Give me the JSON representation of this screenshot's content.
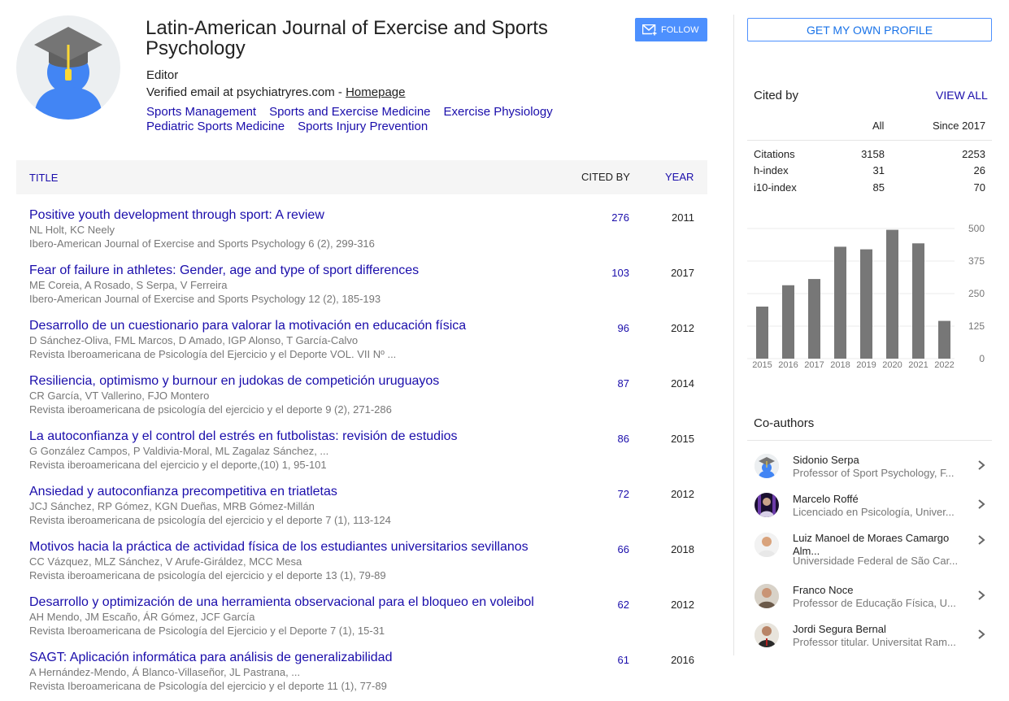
{
  "profile": {
    "name": "Latin-American Journal of Exercise and Sports Psychology",
    "affiliation": "Editor",
    "email_prefix": "Verified email at psychiatryres.com - ",
    "homepage_label": "Homepage",
    "interests": [
      "Sports Management",
      "Sports and Exercise Medicine",
      "Exercise Physiology",
      "Pediatric Sports Medicine",
      "Sports Injury Prevention"
    ],
    "follow_label": "FOLLOW"
  },
  "table": {
    "col_title": "TITLE",
    "col_cited": "CITED BY",
    "col_year": "YEAR",
    "rows": [
      {
        "title": "Positive youth development through sport: A review",
        "authors": "NL Holt, KC Neely",
        "venue": "Ibero-American Journal of Exercise and Sports Psychology 6 (2), 299-316",
        "cited": "276",
        "year": "2011"
      },
      {
        "title": "Fear of failure in athletes: Gender, age and type of sport differences",
        "authors": "ME Coreia, A Rosado, S Serpa, V Ferreira",
        "venue": "Ibero-American Journal of Exercise and Sports Psychology 12 (2), 185-193",
        "cited": "103",
        "year": "2017"
      },
      {
        "title": "Desarrollo de un cuestionario para valorar la motivación en educación física",
        "authors": "D Sánchez-Oliva, FML Marcos, D Amado, IGP Alonso, T García-Calvo",
        "venue": "Revista Iberoamericana de Psicología del Ejercicio y el Deporte VOL. VII Nº ...",
        "cited": "96",
        "year": "2012"
      },
      {
        "title": "Resiliencia, optimismo y burnour en judokas de competición uruguayos",
        "authors": "CR García, VT Vallerino, FJO Montero",
        "venue": "Revista iberoamericana de psicología del ejercicio y el deporte 9 (2), 271-286",
        "cited": "87",
        "year": "2014"
      },
      {
        "title": "La autoconfianza y el control del estrés en futbolistas: revisión de estudios",
        "authors": "G González Campos, P Valdivia-Moral, ML Zagalaz Sánchez, ...",
        "venue": "Revista iberoamericana del ejercicio y el deporte,(10) 1, 95-101",
        "cited": "86",
        "year": "2015"
      },
      {
        "title": "Ansiedad y autoconfianza precompetitiva en triatletas",
        "authors": "JCJ Sánchez, RP Gómez, KGN Dueñas, MRB Gómez-Millán",
        "venue": "Revista iberoamericana de psicología del ejercicio y el deporte 7 (1), 113-124",
        "cited": "72",
        "year": "2012"
      },
      {
        "title": "Motivos hacia la práctica de actividad física de los estudiantes universitarios sevillanos",
        "authors": "CC Vázquez, MLZ Sánchez, V Arufe-Giráldez, MCC Mesa",
        "venue": "Revista iberoamericana de psicología del ejercicio y el deporte 13 (1), 79-89",
        "cited": "66",
        "year": "2018"
      },
      {
        "title": "Desarrollo y optimización de una herramienta observacional para el bloqueo en voleibol",
        "authors": "AH Mendo, JM Escaño, ÁR Gómez, JCF García",
        "venue": "Revista Iberoamericana de Psicología del Ejercicio y el Deporte 7 (1), 15-31",
        "cited": "62",
        "year": "2012"
      },
      {
        "title": "SAGT: Aplicación informática para análisis de generalizabilidad",
        "authors": "A Hernández-Mendo, Á Blanco-Villaseñor, JL Pastrana, ...",
        "venue": "Revista Iberoamericana de Psicología del ejercicio y el deporte 11 (1), 77-89",
        "cited": "61",
        "year": "2016"
      }
    ]
  },
  "sidebar": {
    "profile_button": "GET MY OWN PROFILE",
    "cited_by_heading": "Cited by",
    "view_all": "VIEW ALL",
    "col_all": "All",
    "col_since": "Since 2017",
    "metrics": [
      {
        "label": "Citations",
        "all": "3158",
        "since": "2253"
      },
      {
        "label": "h-index",
        "all": "31",
        "since": "26"
      },
      {
        "label": "i10-index",
        "all": "85",
        "since": "70"
      }
    ],
    "coauthors_heading": "Co-authors",
    "coauthors": [
      {
        "name": "Sidonio Serpa",
        "affiliation": "Professor of Sport Psychology, F..."
      },
      {
        "name": "Marcelo Roffé",
        "affiliation": "Licenciado en Psicología, Univer..."
      },
      {
        "name": "Luiz Manoel de Moraes Camargo Alm...",
        "affiliation": "Universidade Federal de São Car..."
      },
      {
        "name": "Franco Noce",
        "affiliation": "Professor de Educação Física, U..."
      },
      {
        "name": "Jordi Segura Bernal",
        "affiliation": "Professor titular. Universitat Ram..."
      }
    ]
  },
  "chart_data": {
    "type": "bar",
    "categories": [
      "2015",
      "2016",
      "2017",
      "2018",
      "2019",
      "2020",
      "2021",
      "2022"
    ],
    "values": [
      200,
      282,
      306,
      430,
      420,
      495,
      443,
      145
    ],
    "ylim": [
      0,
      500
    ],
    "yticks": [
      "0",
      "125",
      "250",
      "375",
      "500"
    ],
    "title": "",
    "xlabel": "",
    "ylabel": "",
    "bar_color": "#777777"
  },
  "colors": {
    "link": "#1a0dab",
    "accent": "#4d90fe",
    "muted": "#777777"
  }
}
